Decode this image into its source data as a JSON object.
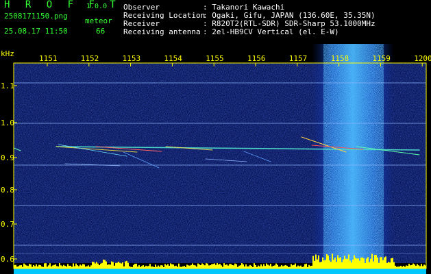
{
  "header": {
    "app_name": "H R O F F T",
    "version": "1.0.0",
    "file_name": "2508171150.png",
    "timestamp": "25.08.17 11:50",
    "meteor_label": "meteor",
    "meteor_count": "66"
  },
  "station_info": [
    {
      "label": "Observer",
      "value": ": Takanori Kawachi"
    },
    {
      "label": "Receiving Location",
      "value": ": Ogaki, Gifu, JAPAN (136.60E, 35.35N)"
    },
    {
      "label": "Receiver",
      "value": ": R820T2(RTL-SDR) SDR-Sharp 53.1000MHz"
    },
    {
      "label": "Receiving antenna",
      "value": ": 2el-HB9CV Vertical (el. E-W)"
    }
  ],
  "axes": {
    "y_unit": "kHz",
    "x_ticks": [
      "1151",
      "1152",
      "1153",
      "1154",
      "1155",
      "1156",
      "1157",
      "1158",
      "1159",
      "1200"
    ],
    "y_ticks": [
      "1.1",
      "1.0",
      "0.9",
      "0.8",
      "0.7",
      "0.6"
    ]
  },
  "colors": {
    "background": "#000000",
    "plot_noise": "#0b1a7a",
    "header_green": "#33ff33",
    "header_white": "#ffffff",
    "axis_yellow": "#ffff00",
    "histogram": "#ffff00",
    "histogram_base": "#00c8ff"
  }
}
